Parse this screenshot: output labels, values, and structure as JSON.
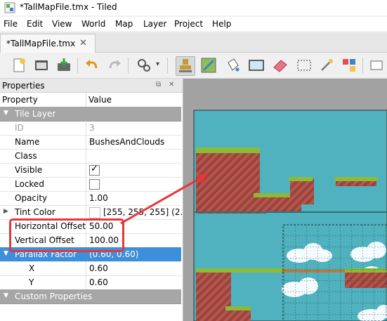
{
  "window": {
    "title": "*TallMapFile.tmx - Tiled",
    "icon": "tiled-app-icon"
  },
  "menu": [
    "File",
    "Edit",
    "View",
    "World",
    "Map",
    "Layer",
    "Project",
    "Help"
  ],
  "tab": {
    "label": "*TallMapFile.tmx",
    "close": "✕"
  },
  "toolbar": {
    "icons": [
      "new-file-icon",
      "open-file-icon",
      "save-file-icon",
      "undo-icon",
      "redo-icon",
      "commands-icon",
      "stamp-brush-icon",
      "terrain-brush-icon",
      "bucket-fill-icon",
      "shape-fill-icon",
      "eraser-icon",
      "rectangle-select-icon",
      "magic-wand-icon",
      "select-same-tile-icon",
      "object-tool-icon"
    ],
    "dropdown": "▾"
  },
  "properties": {
    "panel_title": "Properties",
    "col_property": "Property",
    "col_value": "Value",
    "groups": {
      "tile_layer": "Tile Layer",
      "custom": "Custom Properties"
    },
    "rows": {
      "id": {
        "label": "ID",
        "value": "3"
      },
      "name": {
        "label": "Name",
        "value": "BushesAndClouds"
      },
      "class": {
        "label": "Class",
        "value": ""
      },
      "visible": {
        "label": "Visible",
        "checked": true
      },
      "locked": {
        "label": "Locked",
        "checked": false
      },
      "opacity": {
        "label": "Opacity",
        "value": "1.00"
      },
      "tint": {
        "label": "Tint Color",
        "value": "[255, 255, 255] (2..."
      },
      "hoffset": {
        "label": "Horizontal Offset",
        "value": "50.00"
      },
      "voffset": {
        "label": "Vertical Offset",
        "value": "100.00"
      },
      "parallax": {
        "label": "Parallax Factor",
        "value": "(0.60, 0.60)"
      },
      "px": {
        "label": "X",
        "value": "0.60"
      },
      "py": {
        "label": "Y",
        "value": "0.60"
      }
    }
  },
  "colors": {
    "sky": "#4fb2be",
    "dirt": "#b3564e",
    "grass": "#8dba36",
    "selection": "#3d8edb",
    "highlight": "#e8353a"
  }
}
